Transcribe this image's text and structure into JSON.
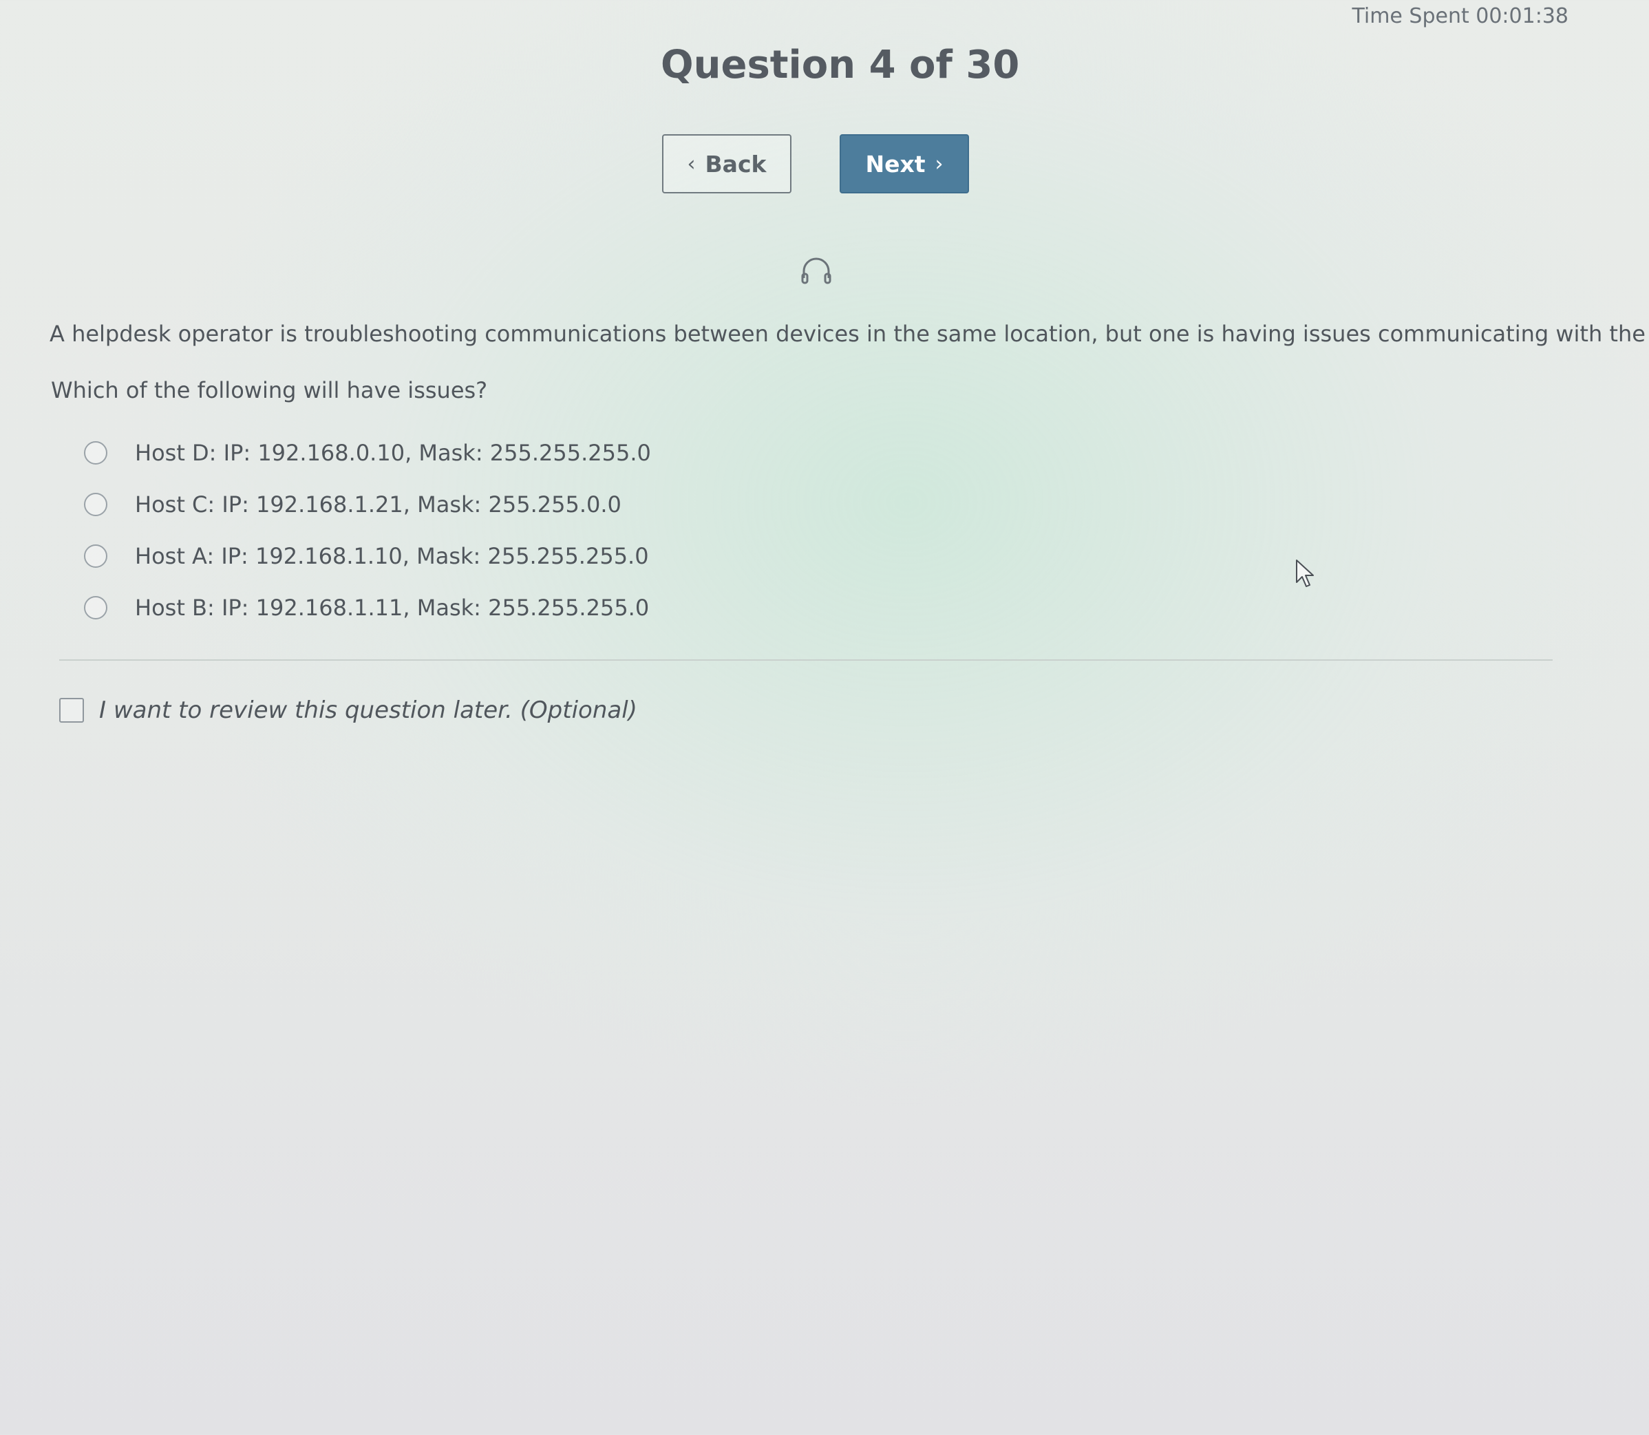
{
  "header": {
    "timer": "Time Spent 00:01:38",
    "title": "Question 4 of 30"
  },
  "nav": {
    "back_label": "Back",
    "next_label": "Next"
  },
  "question": {
    "text": "A helpdesk operator is troubleshooting communications between devices in the same location, but one is having issues communicating with the others.",
    "prompt": "Which of the following will have issues?",
    "options": [
      {
        "label": "Host D: IP: 192.168.0.10, Mask: 255.255.255.0"
      },
      {
        "label": "Host C: IP: 192.168.1.21, Mask: 255.255.0.0"
      },
      {
        "label": "Host A: IP: 192.168.1.10, Mask: 255.255.255.0"
      },
      {
        "label": "Host B: IP: 192.168.1.11, Mask: 255.255.255.0"
      }
    ]
  },
  "review": {
    "label": "I want to review this question later. (Optional)"
  },
  "icons": {
    "audio": "headphones-icon",
    "back": "chevron-left-icon",
    "next": "chevron-right-icon",
    "pointer": "mouse-cursor-icon"
  },
  "colors": {
    "next_button": "#4d7d9c",
    "text": "#50565c"
  }
}
